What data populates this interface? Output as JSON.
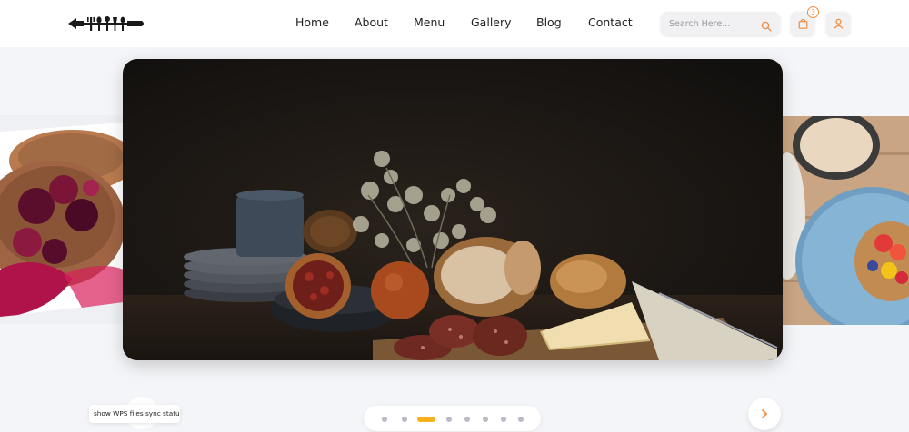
{
  "colors": {
    "accent": "#f08a3c",
    "active_dot": "#f7b21b",
    "inactive_dot": "#b8bcc6",
    "text": "#1f1f1f"
  },
  "header": {
    "logo_icon": "utensils-logo-icon",
    "nav": [
      "Home",
      "About",
      "Menu",
      "Gallery",
      "Blog",
      "Contact"
    ],
    "search": {
      "placeholder": "Search Here...",
      "value": "",
      "icon": "search-icon"
    },
    "cart": {
      "icon": "shopping-bag-icon",
      "count": "3"
    },
    "user": {
      "icon": "user-icon"
    }
  },
  "carousel": {
    "slides": [
      {
        "icon": "berry-pancakes-image"
      },
      {
        "icon": "bread-still-life-image"
      },
      {
        "icon": "strawberry-toast-image"
      }
    ],
    "dots_count": 8,
    "active_dot": 2,
    "next_icon": "chevron-right-icon"
  },
  "status": {
    "wps_text": "show WPS files sync status"
  }
}
